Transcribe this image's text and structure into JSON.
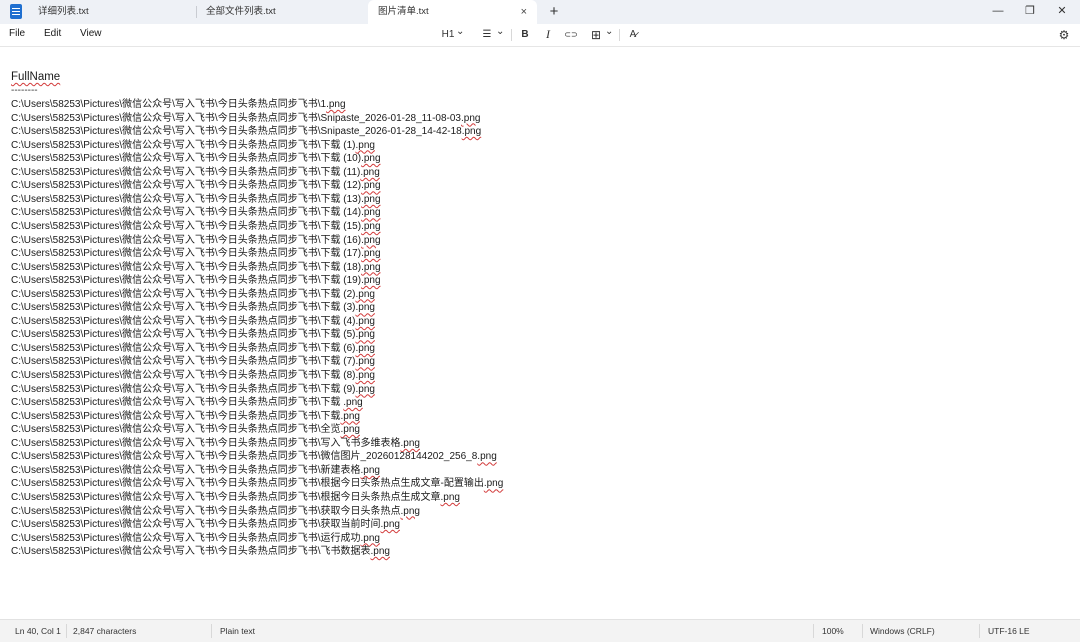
{
  "window": {
    "tabs": [
      {
        "label": "详细列表.txt"
      },
      {
        "label": "全部文件列表.txt"
      },
      {
        "label": "图片清单.txt",
        "active": true
      }
    ],
    "close_tab": "×",
    "new_tab": "+",
    "minimize": "—",
    "maximize": "❐",
    "close": "✕"
  },
  "menu": {
    "file": "File",
    "edit": "Edit",
    "view": "View"
  },
  "toolbar": {
    "heading": "H1",
    "heading_chevron": "⌄",
    "list": "☰",
    "list_chevron": "⌄",
    "bold": "B",
    "italic": "I",
    "link": "⊂⊃",
    "table": "⊞",
    "table_chevron": "⌄",
    "clear_format": "A̷",
    "settings": "⚙"
  },
  "document": {
    "heading": "FullName",
    "separator": "--------",
    "lines": [
      {
        "prefix": "C:\\Users\\58253\\Pictures\\微信公众号\\写入飞书\\今日头条热点同步飞书\\1",
        "ext": ".png"
      },
      {
        "prefix": "C:\\Users\\58253\\Pictures\\微信公众号\\写入飞书\\今日头条热点同步飞书\\Snipaste_2026-01-28_11-08-03",
        "ext": ".png"
      },
      {
        "prefix": "C:\\Users\\58253\\Pictures\\微信公众号\\写入飞书\\今日头条热点同步飞书\\Snipaste_2026-01-28_14-42-18",
        "ext": ".png"
      },
      {
        "prefix": "C:\\Users\\58253\\Pictures\\微信公众号\\写入飞书\\今日头条热点同步飞书\\下载 (1)",
        "ext": ".png"
      },
      {
        "prefix": "C:\\Users\\58253\\Pictures\\微信公众号\\写入飞书\\今日头条热点同步飞书\\下载 (10)",
        "ext": ".png"
      },
      {
        "prefix": "C:\\Users\\58253\\Pictures\\微信公众号\\写入飞书\\今日头条热点同步飞书\\下载 (11)",
        "ext": ".png"
      },
      {
        "prefix": "C:\\Users\\58253\\Pictures\\微信公众号\\写入飞书\\今日头条热点同步飞书\\下载 (12)",
        "ext": ".png"
      },
      {
        "prefix": "C:\\Users\\58253\\Pictures\\微信公众号\\写入飞书\\今日头条热点同步飞书\\下载 (13)",
        "ext": ".png"
      },
      {
        "prefix": "C:\\Users\\58253\\Pictures\\微信公众号\\写入飞书\\今日头条热点同步飞书\\下载 (14)",
        "ext": ".png"
      },
      {
        "prefix": "C:\\Users\\58253\\Pictures\\微信公众号\\写入飞书\\今日头条热点同步飞书\\下载 (15)",
        "ext": ".png"
      },
      {
        "prefix": "C:\\Users\\58253\\Pictures\\微信公众号\\写入飞书\\今日头条热点同步飞书\\下载 (16)",
        "ext": ".png"
      },
      {
        "prefix": "C:\\Users\\58253\\Pictures\\微信公众号\\写入飞书\\今日头条热点同步飞书\\下载 (17)",
        "ext": ".png"
      },
      {
        "prefix": "C:\\Users\\58253\\Pictures\\微信公众号\\写入飞书\\今日头条热点同步飞书\\下载 (18)",
        "ext": ".png"
      },
      {
        "prefix": "C:\\Users\\58253\\Pictures\\微信公众号\\写入飞书\\今日头条热点同步飞书\\下载 (19)",
        "ext": ".png"
      },
      {
        "prefix": "C:\\Users\\58253\\Pictures\\微信公众号\\写入飞书\\今日头条热点同步飞书\\下载 (2)",
        "ext": ".png"
      },
      {
        "prefix": "C:\\Users\\58253\\Pictures\\微信公众号\\写入飞书\\今日头条热点同步飞书\\下载 (3)",
        "ext": ".png"
      },
      {
        "prefix": "C:\\Users\\58253\\Pictures\\微信公众号\\写入飞书\\今日头条热点同步飞书\\下载 (4)",
        "ext": ".png"
      },
      {
        "prefix": "C:\\Users\\58253\\Pictures\\微信公众号\\写入飞书\\今日头条热点同步飞书\\下载 (5)",
        "ext": ".png"
      },
      {
        "prefix": "C:\\Users\\58253\\Pictures\\微信公众号\\写入飞书\\今日头条热点同步飞书\\下载 (6)",
        "ext": ".png"
      },
      {
        "prefix": "C:\\Users\\58253\\Pictures\\微信公众号\\写入飞书\\今日头条热点同步飞书\\下载 (7)",
        "ext": ".png"
      },
      {
        "prefix": "C:\\Users\\58253\\Pictures\\微信公众号\\写入飞书\\今日头条热点同步飞书\\下载 (8)",
        "ext": ".png"
      },
      {
        "prefix": "C:\\Users\\58253\\Pictures\\微信公众号\\写入飞书\\今日头条热点同步飞书\\下载 (9)",
        "ext": ".png"
      },
      {
        "prefix": "C:\\Users\\58253\\Pictures\\微信公众号\\写入飞书\\今日头条热点同步飞书\\下载 ",
        "ext": ".png"
      },
      {
        "prefix": "C:\\Users\\58253\\Pictures\\微信公众号\\写入飞书\\今日头条热点同步飞书\\下载",
        "ext": ".png"
      },
      {
        "prefix": "C:\\Users\\58253\\Pictures\\微信公众号\\写入飞书\\今日头条热点同步飞书\\全览",
        "ext": ".png"
      },
      {
        "prefix": "C:\\Users\\58253\\Pictures\\微信公众号\\写入飞书\\今日头条热点同步飞书\\写入飞书多维表格",
        "ext": ".png"
      },
      {
        "prefix": "C:\\Users\\58253\\Pictures\\微信公众号\\写入飞书\\今日头条热点同步飞书\\微信图片_20260128144202_256_8",
        "ext": ".png"
      },
      {
        "prefix": "C:\\Users\\58253\\Pictures\\微信公众号\\写入飞书\\今日头条热点同步飞书\\新建表格",
        "ext": ".png"
      },
      {
        "prefix": "C:\\Users\\58253\\Pictures\\微信公众号\\写入飞书\\今日头条热点同步飞书\\根据今日头条热点生成文章-配置输出",
        "ext": ".png"
      },
      {
        "prefix": "C:\\Users\\58253\\Pictures\\微信公众号\\写入飞书\\今日头条热点同步飞书\\根据今日头条热点生成文章",
        "ext": ".png"
      },
      {
        "prefix": "C:\\Users\\58253\\Pictures\\微信公众号\\写入飞书\\今日头条热点同步飞书\\获取今日头条热点",
        "ext": ".png"
      },
      {
        "prefix": "C:\\Users\\58253\\Pictures\\微信公众号\\写入飞书\\今日头条热点同步飞书\\获取当前时间",
        "ext": ".png"
      },
      {
        "prefix": "C:\\Users\\58253\\Pictures\\微信公众号\\写入飞书\\今日头条热点同步飞书\\运行成功",
        "ext": ".png"
      },
      {
        "prefix": "C:\\Users\\58253\\Pictures\\微信公众号\\写入飞书\\今日头条热点同步飞书\\飞书数据表",
        "ext": ".png"
      }
    ]
  },
  "status": {
    "position": "Ln 40, Col 1",
    "characters": "2,847 characters",
    "format": "Plain text",
    "zoom": "100%",
    "line_ending": "Windows (CRLF)",
    "encoding": "UTF-16 LE"
  }
}
